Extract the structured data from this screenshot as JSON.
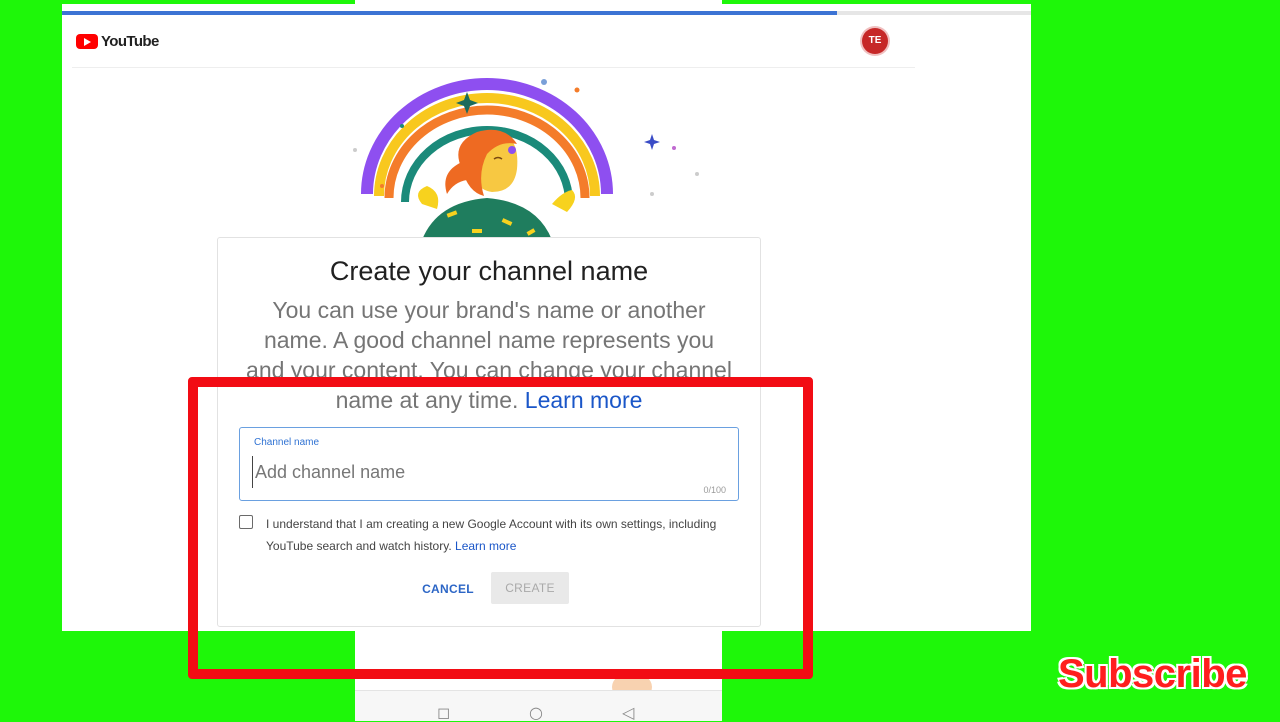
{
  "app": {
    "logo_text": "YouTube",
    "avatar_text": "TE",
    "progress": 0.8
  },
  "dialog": {
    "title": "Create your channel name",
    "subtitle": "You can use your brand's name or another name. A good channel name represents you and your content. You can change your channel name at any time.",
    "subtitle_link": "Learn more",
    "field": {
      "label": "Channel name",
      "placeholder": "Add channel name",
      "value": "",
      "counter": "0/100"
    },
    "checkbox": {
      "checked": false,
      "text": "I understand that I am creating a new Google Account with its own settings, including YouTube search and watch history.",
      "link": "Learn more"
    },
    "buttons": {
      "cancel": "CANCEL",
      "create": "CREATE"
    }
  },
  "overlay": {
    "subscribe_text": "Subscribe",
    "highlight_color": "#f20c14",
    "background_color": "#1ef709"
  },
  "phone_nav": {
    "icons": [
      "square-icon",
      "circle-icon",
      "triangle-back-icon"
    ]
  }
}
